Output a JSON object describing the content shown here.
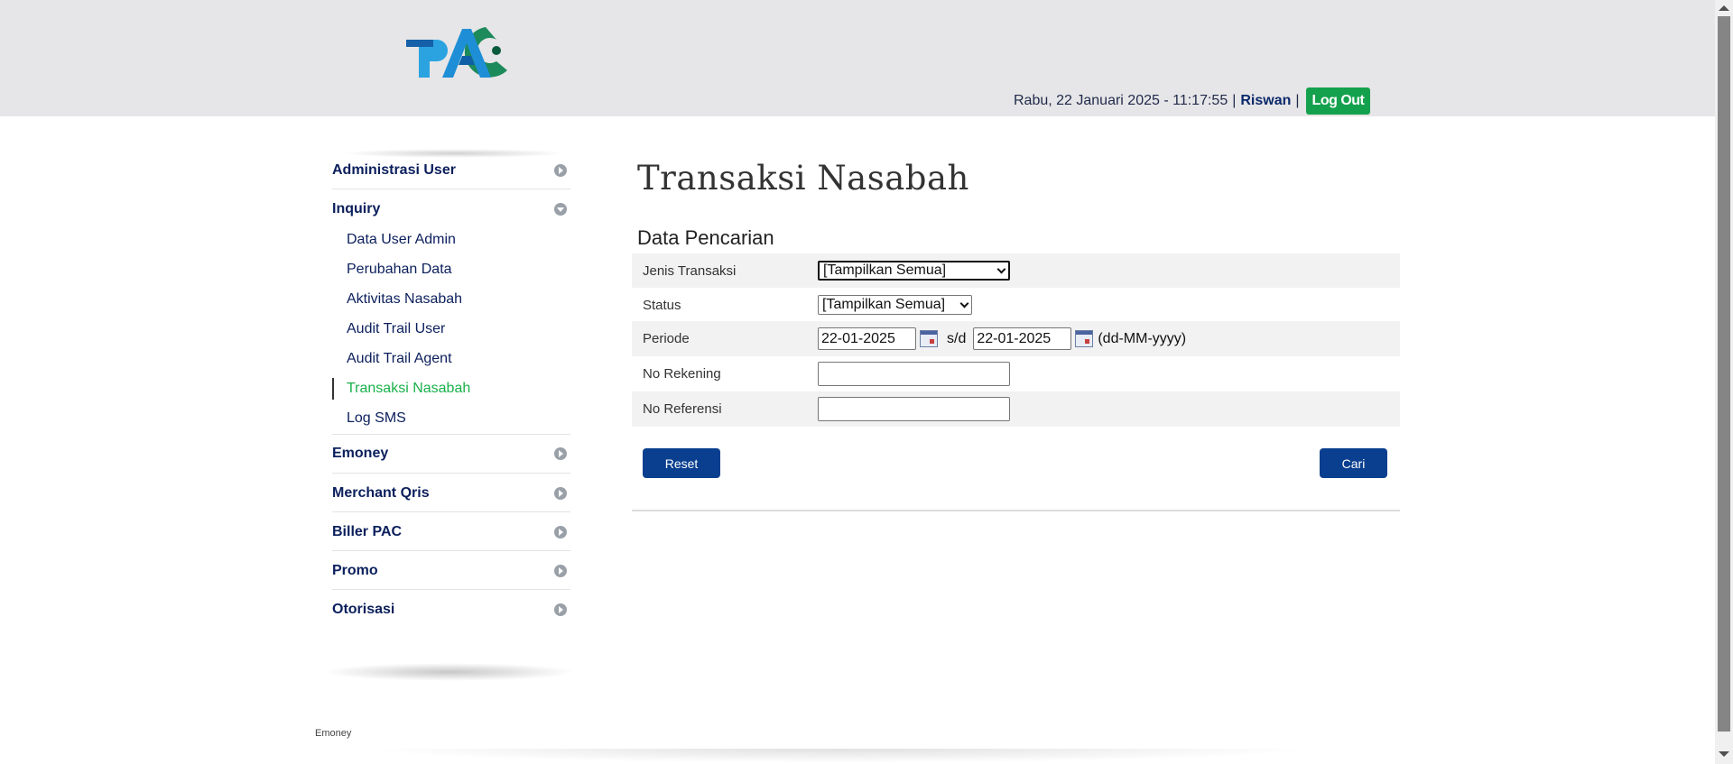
{
  "header": {
    "logo_alt": "PAC",
    "datetime": "Rabu, 22 Januari 2025 - 11:17:55",
    "separator": "|",
    "username": "Riswan",
    "logout_label": "Log Out",
    "colors": {
      "background": "#e6e5e7",
      "logout": "#14a14e"
    }
  },
  "sidebar": {
    "groups": [
      {
        "label": "Administrasi User",
        "icon": "circle-arrow-right-icon"
      },
      {
        "label": "Inquiry",
        "icon": "circle-arrow-down-icon",
        "items": [
          {
            "label": "Data User Admin"
          },
          {
            "label": "Perubahan Data"
          },
          {
            "label": "Aktivitas Nasabah"
          },
          {
            "label": "Audit Trail User"
          },
          {
            "label": "Audit Trail Agent"
          },
          {
            "label": "Transaksi Nasabah",
            "active": true
          },
          {
            "label": "Log SMS"
          }
        ]
      },
      {
        "label": "Emoney",
        "icon": "circle-arrow-right-icon"
      },
      {
        "label": "Merchant Qris",
        "icon": "circle-arrow-right-icon"
      },
      {
        "label": "Biller PAC",
        "icon": "circle-arrow-right-icon"
      },
      {
        "label": "Promo",
        "icon": "circle-arrow-right-icon"
      },
      {
        "label": "Otorisasi",
        "icon": "circle-arrow-right-icon"
      }
    ],
    "colors": {
      "text": "#0b1f5c",
      "active": "#19b14a"
    }
  },
  "main": {
    "title": "Transaksi Nasabah",
    "section_title": "Data Pencarian",
    "form": {
      "jenis_transaksi": {
        "label": "Jenis Transaksi",
        "value": "[Tampilkan Semua]"
      },
      "status": {
        "label": "Status",
        "value": "[Tampilkan Semua]"
      },
      "periode": {
        "label": "Periode",
        "from": "22-01-2025",
        "separator": "s/d",
        "to": "22-01-2025",
        "format_hint": "(dd-MM-yyyy)"
      },
      "no_rekening": {
        "label": "No Rekening",
        "value": ""
      },
      "no_referensi": {
        "label": "No Referensi",
        "value": ""
      }
    },
    "buttons": {
      "reset": "Reset",
      "search": "Cari"
    },
    "colors": {
      "button": "#0a3f8f",
      "row_shade": "#f2f2f2"
    }
  },
  "footer": {
    "text": "Emoney"
  }
}
